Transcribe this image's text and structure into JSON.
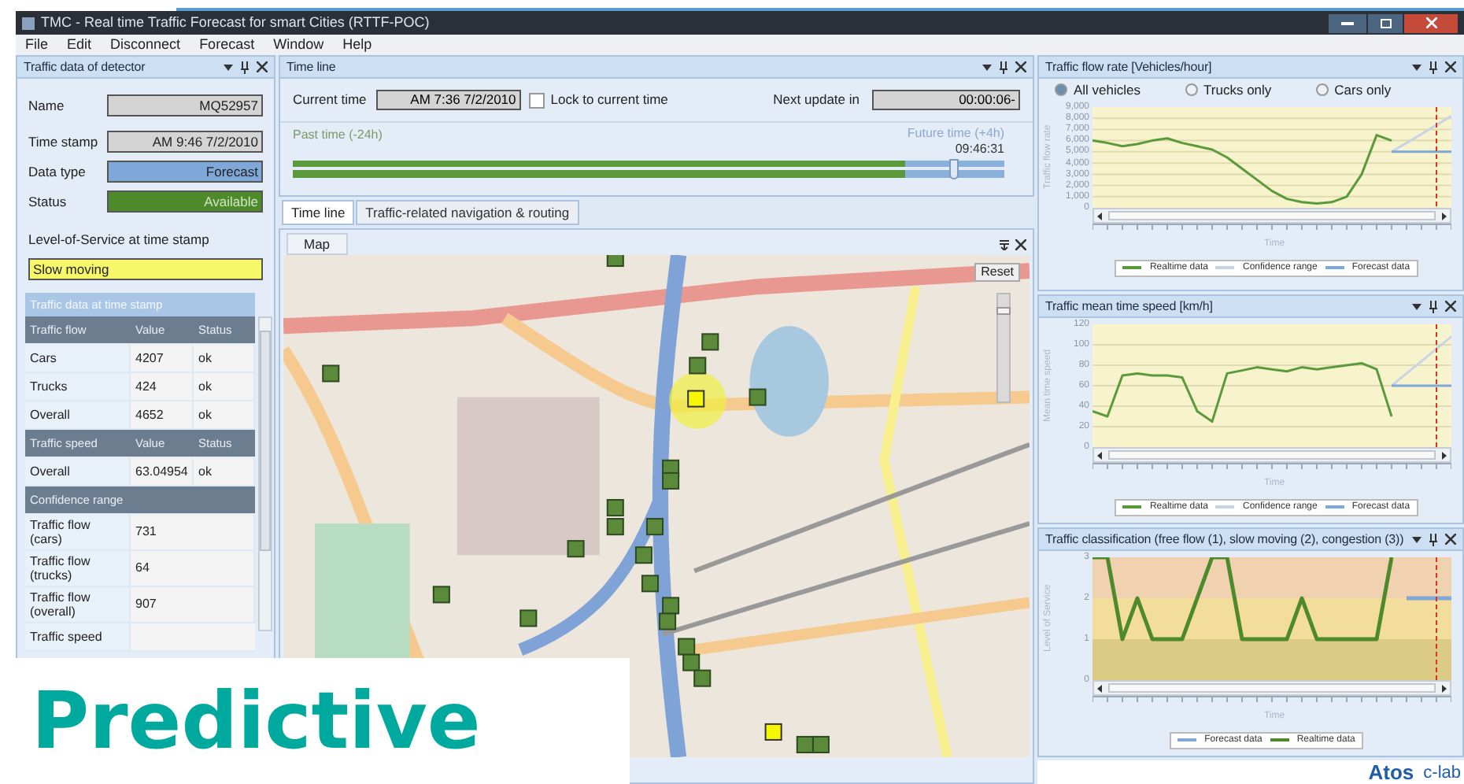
{
  "window": {
    "title": "TMC - Real time Traffic Forecast for smart Cities (RTTF-POC)",
    "menu": [
      "File",
      "Edit",
      "Disconnect",
      "Forecast",
      "Window",
      "Help"
    ]
  },
  "detector_panel": {
    "title": "Traffic data of detector",
    "fields": [
      {
        "label": "Name",
        "value": "MQ52957",
        "color": "#d4d4d4"
      },
      {
        "label": "Time stamp",
        "value": "AM 9:46 7/2/2010",
        "color": "#d4d4d4"
      },
      {
        "label": "Data type",
        "value": "Forecast",
        "color": "#7fa8d8"
      },
      {
        "label": "Status",
        "value": "Available",
        "color": "#4e8a2c"
      }
    ],
    "los_label": "Level-of-Service at time stamp",
    "los_value": "Slow moving",
    "table": {
      "title": "Traffic data at time stamp",
      "sections": [
        {
          "header": [
            "Traffic flow",
            "Value",
            "Status"
          ],
          "rows": [
            [
              "Cars",
              "4207",
              "ok"
            ],
            [
              "Trucks",
              "424",
              "ok"
            ],
            [
              "Overall",
              "4652",
              "ok"
            ]
          ]
        },
        {
          "header": [
            "Traffic speed",
            "Value",
            "Status"
          ],
          "rows": [
            [
              "Overall",
              "63.04954",
              "ok"
            ]
          ]
        },
        {
          "header": [
            "Confidence range"
          ],
          "rows": [
            [
              "Traffic flow (cars)",
              "731"
            ],
            [
              "Traffic flow (trucks)",
              "64"
            ],
            [
              "Traffic flow (overall)",
              "907"
            ],
            [
              "Traffic speed"
            ]
          ]
        }
      ]
    }
  },
  "timeline_panel": {
    "title": "Time line",
    "current_time_label": "Current time",
    "current_time": "AM 7:36 7/2/2010",
    "lock_label": "Lock to current time",
    "lock_checked": false,
    "next_update_label": "Next update in",
    "next_update": "00:00:06-",
    "past_label": "Past time (-24h)",
    "future_label": "Future time (+4h)",
    "future_time": "09:46:31",
    "level": 0.93
  },
  "tabs": [
    {
      "label": "Time line",
      "selected": true
    },
    {
      "label": "Traffic-related navigation & routing",
      "selected": false
    }
  ],
  "map_panel": {
    "tab": "Map",
    "reset": "Reset",
    "zoom": {
      "level": 0.88
    }
  },
  "charts": [
    {
      "kind": "flow",
      "title": "Traffic flow rate [Vehicles/hour]",
      "options": [
        {
          "label": "All vehicles",
          "selected": true
        },
        {
          "label": "Trucks only",
          "selected": false
        },
        {
          "label": "Cars only",
          "selected": false
        }
      ],
      "chart_data": {
        "type": "line",
        "xlabel": "Time",
        "ylabel": "Traffic flow rate",
        "ylim": [
          0,
          9000
        ],
        "grid": true,
        "yticks": [
          {
            "value": 9000,
            "label": "9,000"
          },
          {
            "value": 8000,
            "label": "8,000"
          },
          {
            "value": 7000,
            "label": "7,000"
          },
          {
            "value": 6000,
            "label": "6,000"
          },
          {
            "value": 5000,
            "label": "5,000"
          },
          {
            "value": 4000,
            "label": "4,000"
          },
          {
            "value": 3000,
            "label": "3,000"
          },
          {
            "value": 2000,
            "label": "2,000"
          },
          {
            "value": 1000,
            "label": "1,000"
          },
          {
            "value": 0,
            "label": "0"
          }
        ],
        "series": [
          {
            "name": "Realtime data",
            "color": "#5a9a3a",
            "values": [
              6000,
              5800,
              5500,
              5700,
              6000,
              6200,
              5800,
              5500,
              5200,
              4500,
              3500,
              2500,
              1500,
              800,
              500,
              400,
              500,
              1000,
              3000,
              6500,
              6000,
              null,
              null,
              null,
              null
            ]
          },
          {
            "name": "Confidence range",
            "color": "#c8d4e4",
            "values": [
              null,
              null,
              null,
              null,
              null,
              null,
              null,
              null,
              null,
              null,
              null,
              null,
              null,
              null,
              null,
              null,
              null,
              null,
              null,
              null,
              5000,
              5800,
              6600,
              7400,
              8200
            ]
          },
          {
            "name": "Forecast data",
            "color": "#7fa8d8",
            "values": [
              null,
              null,
              null,
              null,
              null,
              null,
              null,
              null,
              null,
              null,
              null,
              null,
              null,
              null,
              null,
              null,
              null,
              null,
              null,
              null,
              5000,
              5000,
              5000,
              5000,
              5000
            ]
          }
        ]
      }
    },
    {
      "kind": "speed",
      "title": "Traffic mean time speed [km/h]",
      "chart_data": {
        "type": "line",
        "xlabel": "Time",
        "ylabel": "Mean time speed",
        "ylim": [
          0,
          120
        ],
        "grid": true,
        "yticks": [
          120,
          100,
          80,
          60,
          40,
          20,
          0
        ],
        "series": [
          {
            "name": "Realtime data",
            "color": "#5a9a3a",
            "values": [
              35,
              30,
              70,
              72,
              70,
              70,
              68,
              35,
              25,
              72,
              75,
              78,
              76,
              74,
              78,
              76,
              78,
              80,
              82,
              76,
              30,
              null,
              null,
              null,
              null
            ]
          },
          {
            "name": "Confidence range",
            "color": "#c8d4e4",
            "values": [
              null,
              null,
              null,
              null,
              null,
              null,
              null,
              null,
              null,
              null,
              null,
              null,
              null,
              null,
              null,
              null,
              null,
              null,
              null,
              null,
              60,
              72,
              84,
              96,
              108
            ]
          },
          {
            "name": "Forecast data",
            "color": "#7fa8d8",
            "values": [
              null,
              null,
              null,
              null,
              null,
              null,
              null,
              null,
              null,
              null,
              null,
              null,
              null,
              null,
              null,
              null,
              null,
              null,
              null,
              null,
              60,
              60,
              60,
              60,
              60
            ]
          }
        ]
      }
    },
    {
      "kind": "classification",
      "title": "Traffic classification (free flow (1), slow moving (2), congestion (3))",
      "chart_data": {
        "type": "line",
        "xlabel": "Time",
        "ylabel": "Level of Service",
        "ylim": [
          0,
          3
        ],
        "bands": [
          {
            "axis": "y",
            "from": 2,
            "to": 3,
            "color": "#f0d2b0"
          },
          {
            "axis": "y",
            "from": 1,
            "to": 2,
            "color": "#f3dd9c"
          },
          {
            "axis": "y",
            "from": 0,
            "to": 1,
            "color": "#dccb84"
          }
        ],
        "yticks": [
          3,
          2,
          1,
          0
        ],
        "series": [
          {
            "name": "Forecast data",
            "color": "#7fa8d8",
            "values": [
              null,
              null,
              null,
              null,
              null,
              null,
              null,
              null,
              null,
              null,
              null,
              null,
              null,
              null,
              null,
              null,
              null,
              null,
              null,
              null,
              null,
              2,
              2,
              2,
              2
            ]
          },
          {
            "name": "Realtime data",
            "color": "#4e8a2c",
            "values": [
              3,
              3,
              1,
              2,
              1,
              1,
              1,
              2,
              3,
              3,
              1,
              1,
              1,
              1,
              2,
              1,
              1,
              1,
              1,
              1,
              3,
              null,
              null,
              null,
              null
            ]
          }
        ]
      }
    }
  ],
  "slide": {
    "title": "Predictive",
    "logo": "Atos",
    "logo_sub": "c-lab"
  }
}
